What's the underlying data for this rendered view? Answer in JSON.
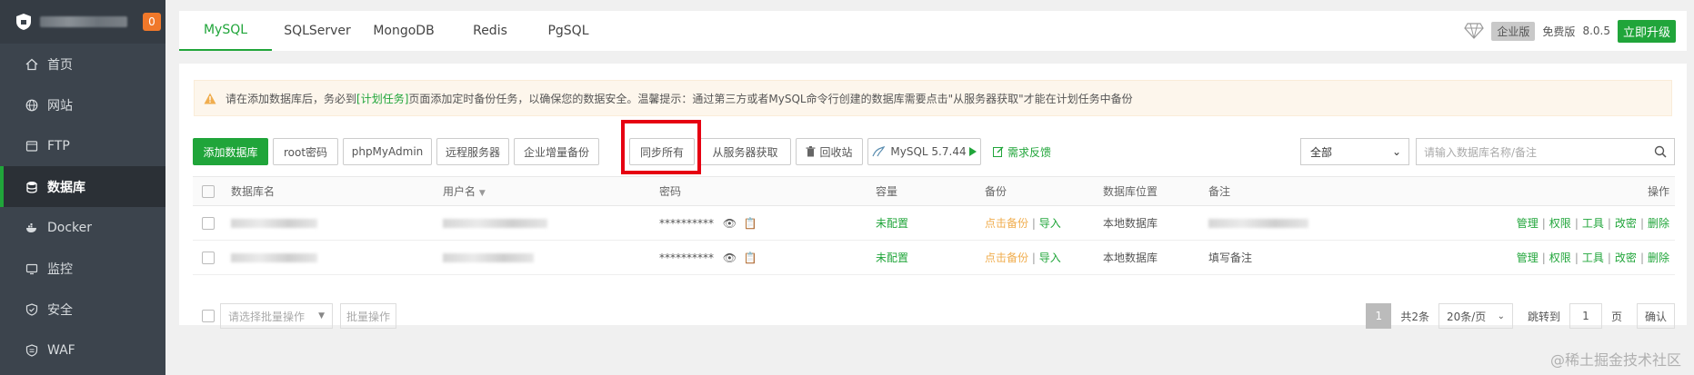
{
  "sidebar": {
    "badge": "0",
    "items": [
      {
        "label": "首页",
        "icon": "home-icon"
      },
      {
        "label": "网站",
        "icon": "globe-icon"
      },
      {
        "label": "FTP",
        "icon": "ftp-icon"
      },
      {
        "label": "数据库",
        "icon": "database-icon",
        "active": true
      },
      {
        "label": "Docker",
        "icon": "docker-icon"
      },
      {
        "label": "监控",
        "icon": "monitor-icon"
      },
      {
        "label": "安全",
        "icon": "shield-check-icon"
      },
      {
        "label": "WAF",
        "icon": "waf-icon"
      }
    ]
  },
  "tabs": [
    "MySQL",
    "SQLServer",
    "MongoDB",
    "Redis",
    "PgSQL"
  ],
  "topright": {
    "enterprise": "企业版",
    "free": "免费版",
    "version": "8.0.5",
    "upgrade": "立即升级"
  },
  "notice": {
    "pre": "请在添加数据库后，务必到",
    "link": "[计划任务]",
    "post": "页面添加定时备份任务，以确保您的数据安全。温馨提示：通过第三方或者MySQL命令行创建的数据库需要点击\"从服务器获取\"才能在计划任务中备份"
  },
  "toolbar": {
    "add": "添加数据库",
    "root_pwd": "root密码",
    "phpmyadmin": "phpMyAdmin",
    "remote": "远程服务器",
    "incr_backup": "企业增量备份",
    "sync_all": "同步所有",
    "fetch": "从服务器获取",
    "recycle": "回收站",
    "mysql_ver": "MySQL 5.7.44",
    "feedback": "需求反馈",
    "filter": "全部",
    "search_placeholder": "请输入数据库名称/备注"
  },
  "table": {
    "headers": [
      "数据库名",
      "用户名",
      "密码",
      "容量",
      "备份",
      "数据库位置",
      "备注",
      "操作"
    ],
    "rows": [
      {
        "password": "**********",
        "capacity": "未配置",
        "backup": "点击备份",
        "import": "导入",
        "location": "本地数据库",
        "note": ""
      },
      {
        "password": "**********",
        "capacity": "未配置",
        "backup": "点击备份",
        "import": "导入",
        "location": "本地数据库",
        "note": "填写备注"
      }
    ],
    "ops": [
      "管理",
      "权限",
      "工具",
      "改密",
      "删除"
    ]
  },
  "bottom": {
    "batch_placeholder": "请选择批量操作",
    "batch_btn": "批量操作",
    "page": "1",
    "total": "共2条",
    "per_page": "20条/页",
    "jump_label": "跳转到",
    "jump_value": "1",
    "page_unit": "页",
    "confirm": "确认"
  },
  "watermark": "@稀土掘金技术社区",
  "colors": {
    "accent": "#20a53a",
    "sidebar": "#3c444d",
    "highlight": "#e60012"
  }
}
